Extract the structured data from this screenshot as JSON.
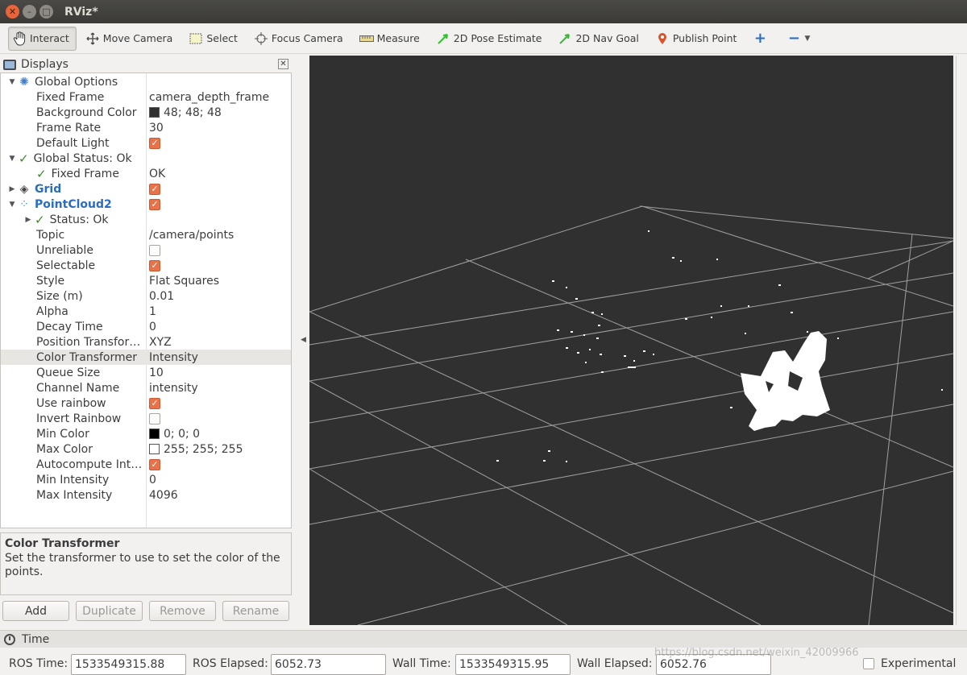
{
  "window": {
    "title": "RViz*"
  },
  "toolbar": {
    "interact": "Interact",
    "move_camera": "Move Camera",
    "select": "Select",
    "focus_camera": "Focus Camera",
    "measure": "Measure",
    "pose_estimate": "2D Pose Estimate",
    "nav_goal": "2D Nav Goal",
    "publish_point": "Publish Point"
  },
  "displays": {
    "title": "Displays",
    "rows": [
      {
        "name": "Global Options",
        "value": ""
      },
      {
        "name": "Fixed Frame",
        "value": "camera_depth_frame"
      },
      {
        "name": "Background Color",
        "value": "48; 48; 48"
      },
      {
        "name": "Frame Rate",
        "value": "30"
      },
      {
        "name": "Default Light",
        "value": ""
      },
      {
        "name": "Global Status: Ok",
        "value": ""
      },
      {
        "name": "Fixed Frame",
        "value": "OK"
      },
      {
        "name": "Grid",
        "value": ""
      },
      {
        "name": "PointCloud2",
        "value": ""
      },
      {
        "name": "Status: Ok",
        "value": ""
      },
      {
        "name": "Topic",
        "value": "/camera/points"
      },
      {
        "name": "Unreliable",
        "value": ""
      },
      {
        "name": "Selectable",
        "value": ""
      },
      {
        "name": "Style",
        "value": "Flat Squares"
      },
      {
        "name": "Size (m)",
        "value": "0.01"
      },
      {
        "name": "Alpha",
        "value": "1"
      },
      {
        "name": "Decay Time",
        "value": "0"
      },
      {
        "name": "Position Transfor…",
        "value": "XYZ"
      },
      {
        "name": "Color Transformer",
        "value": "Intensity"
      },
      {
        "name": "Queue Size",
        "value": "10"
      },
      {
        "name": "Channel Name",
        "value": "intensity"
      },
      {
        "name": "Use rainbow",
        "value": ""
      },
      {
        "name": "Invert Rainbow",
        "value": ""
      },
      {
        "name": "Min Color",
        "value": "0; 0; 0"
      },
      {
        "name": "Max Color",
        "value": "255; 255; 255"
      },
      {
        "name": "Autocompute Int…",
        "value": ""
      },
      {
        "name": "Min Intensity",
        "value": "0"
      },
      {
        "name": "Max Intensity",
        "value": "4096"
      }
    ],
    "colors": {
      "background_color": "#303030",
      "min_color": "#000000",
      "max_color": "#ffffff",
      "checkbox_on": "#e8734a"
    }
  },
  "description": {
    "title": "Color Transformer",
    "text": "Set the transformer to use to set the color of the points."
  },
  "buttons": {
    "add": "Add",
    "duplicate": "Duplicate",
    "remove": "Remove",
    "rename": "Rename"
  },
  "time": {
    "title": "Time",
    "ros_time_label": "ROS Time:",
    "ros_time": "1533549315.88",
    "ros_elapsed_label": "ROS Elapsed:",
    "ros_elapsed": "6052.73",
    "wall_time_label": "Wall Time:",
    "wall_time": "1533549315.95",
    "wall_elapsed_label": "Wall Elapsed:",
    "wall_elapsed": "6052.76",
    "experimental_label": "Experimental"
  },
  "watermark": "https://blog.csdn.net/weixin_42009966"
}
